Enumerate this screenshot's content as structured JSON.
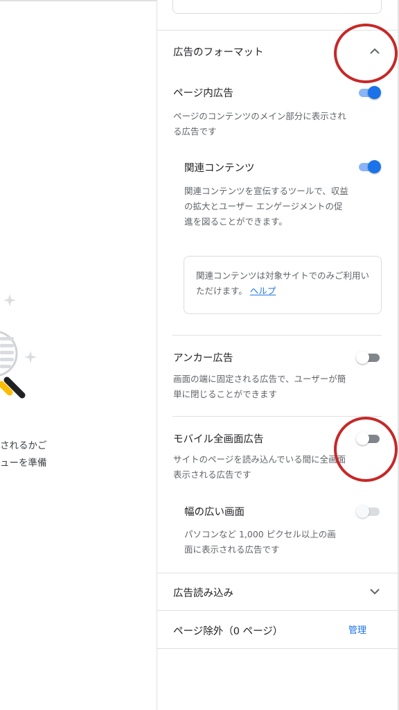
{
  "left_fragment": {
    "line1": "されるかご",
    "line2": "ューを準備"
  },
  "ad_formats": {
    "title": "広告のフォーマット",
    "in_page": {
      "title": "ページ内広告",
      "description": "ページのコンテンツのメイン部分に表示される広告です",
      "enabled": true
    },
    "related_content": {
      "title": "関連コンテンツ",
      "description": "関連コンテンツを宣伝するツールで、収益の拡大とユーザー エンゲージメントの促進を図ることができます。",
      "enabled": true,
      "notice_text": "関連コンテンツは対象サイトでのみご利用いただけます。",
      "notice_link": "ヘルプ"
    },
    "anchor": {
      "title": "アンカー広告",
      "description": "画面の端に固定される広告で、ユーザーが簡単に閉じることができます",
      "enabled": false
    },
    "vignette": {
      "title": "モバイル全画面広告",
      "description": "サイトのページを読み込んでいる間に全画面表示される広告です",
      "enabled": false
    },
    "wide_screen": {
      "title": "幅の広い画面",
      "description": "パソコンなど 1,000 ピクセル以上の画面に表示される広告です",
      "enabled": false
    }
  },
  "ad_load": {
    "title": "広告読み込み"
  },
  "page_exclusions": {
    "title": "ページ除外（0 ページ）",
    "manage_label": "管理"
  },
  "icons": {
    "collapse": "chevron-up-icon",
    "expand": "chevron-down-icon"
  },
  "colors": {
    "toggle_on": "#1a73e8",
    "link": "#1a73e8",
    "annotation": "#c62828"
  }
}
